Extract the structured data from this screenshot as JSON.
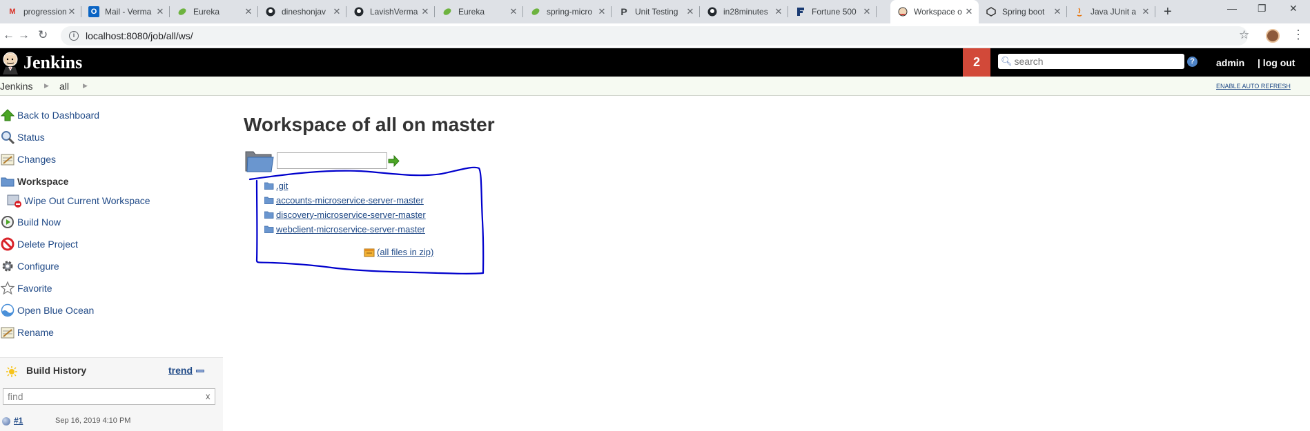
{
  "browser": {
    "tabs": [
      {
        "title": "progression",
        "icon": "gmail-icon",
        "active": false
      },
      {
        "title": "Mail - Verma",
        "icon": "outlook-icon",
        "active": false
      },
      {
        "title": "Eureka",
        "icon": "spring-leaf-icon",
        "active": false
      },
      {
        "title": "dineshonjav",
        "icon": "github-icon",
        "active": false
      },
      {
        "title": "LavishVerma",
        "icon": "github-icon",
        "active": false
      },
      {
        "title": "Eureka",
        "icon": "spring-leaf-icon",
        "active": false
      },
      {
        "title": "spring-micro",
        "icon": "spring-leaf-icon",
        "active": false
      },
      {
        "title": "Unit Testing",
        "icon": "p-letter-icon",
        "active": false
      },
      {
        "title": "in28minutes",
        "icon": "github-icon",
        "active": false
      },
      {
        "title": "Fortune 500",
        "icon": "fortune-icon",
        "active": false
      },
      {
        "title": "Workspace o",
        "icon": "jenkins-icon",
        "active": true
      },
      {
        "title": "Spring boot",
        "icon": "spring-boot-icon",
        "active": false
      },
      {
        "title": "Java JUnit a",
        "icon": "java-icon",
        "active": false
      }
    ],
    "url": "localhost:8080/job/all/ws/"
  },
  "jenkins": {
    "brand": "Jenkins",
    "notification_count": "2",
    "search_placeholder": "search",
    "help": "?",
    "user": "admin",
    "logout": "| log out"
  },
  "breadcrumb": {
    "items": [
      "Jenkins",
      "all"
    ],
    "auto_refresh": "ENABLE AUTO REFRESH"
  },
  "sidebar": {
    "tasks": [
      {
        "label": "Back to Dashboard",
        "icon": "up-arrow-icon"
      },
      {
        "label": "Status",
        "icon": "magnifier-icon"
      },
      {
        "label": "Changes",
        "icon": "notepad-icon"
      },
      {
        "label": "Workspace",
        "icon": "folder-icon"
      },
      {
        "label": "Wipe Out Current Workspace",
        "icon": "wipe-workspace-icon"
      },
      {
        "label": "Build Now",
        "icon": "clock-build-icon"
      },
      {
        "label": "Delete Project",
        "icon": "no-entry-icon"
      },
      {
        "label": "Configure",
        "icon": "gear-icon"
      },
      {
        "label": "Favorite",
        "icon": "star-icon"
      },
      {
        "label": "Open Blue Ocean",
        "icon": "blue-ocean-icon"
      },
      {
        "label": "Rename",
        "icon": "notepad-icon"
      }
    ]
  },
  "build_history": {
    "title": "Build History",
    "trend": "trend",
    "find_placeholder": "find",
    "clear": "x",
    "builds": [
      {
        "number": "#1",
        "date": "Sep 16, 2019 4:10 PM"
      }
    ]
  },
  "main": {
    "title": "Workspace of all on master",
    "files": [
      ".git",
      "accounts-microservice-server-master",
      "discovery-microservice-server-master",
      "webclient-microservice-server-master"
    ],
    "zip_label": "(all files in zip)"
  },
  "colors": {
    "header_bg": "#000000",
    "notification_bg": "#d24939",
    "link": "#204a87",
    "annotation": "#0000cc"
  }
}
